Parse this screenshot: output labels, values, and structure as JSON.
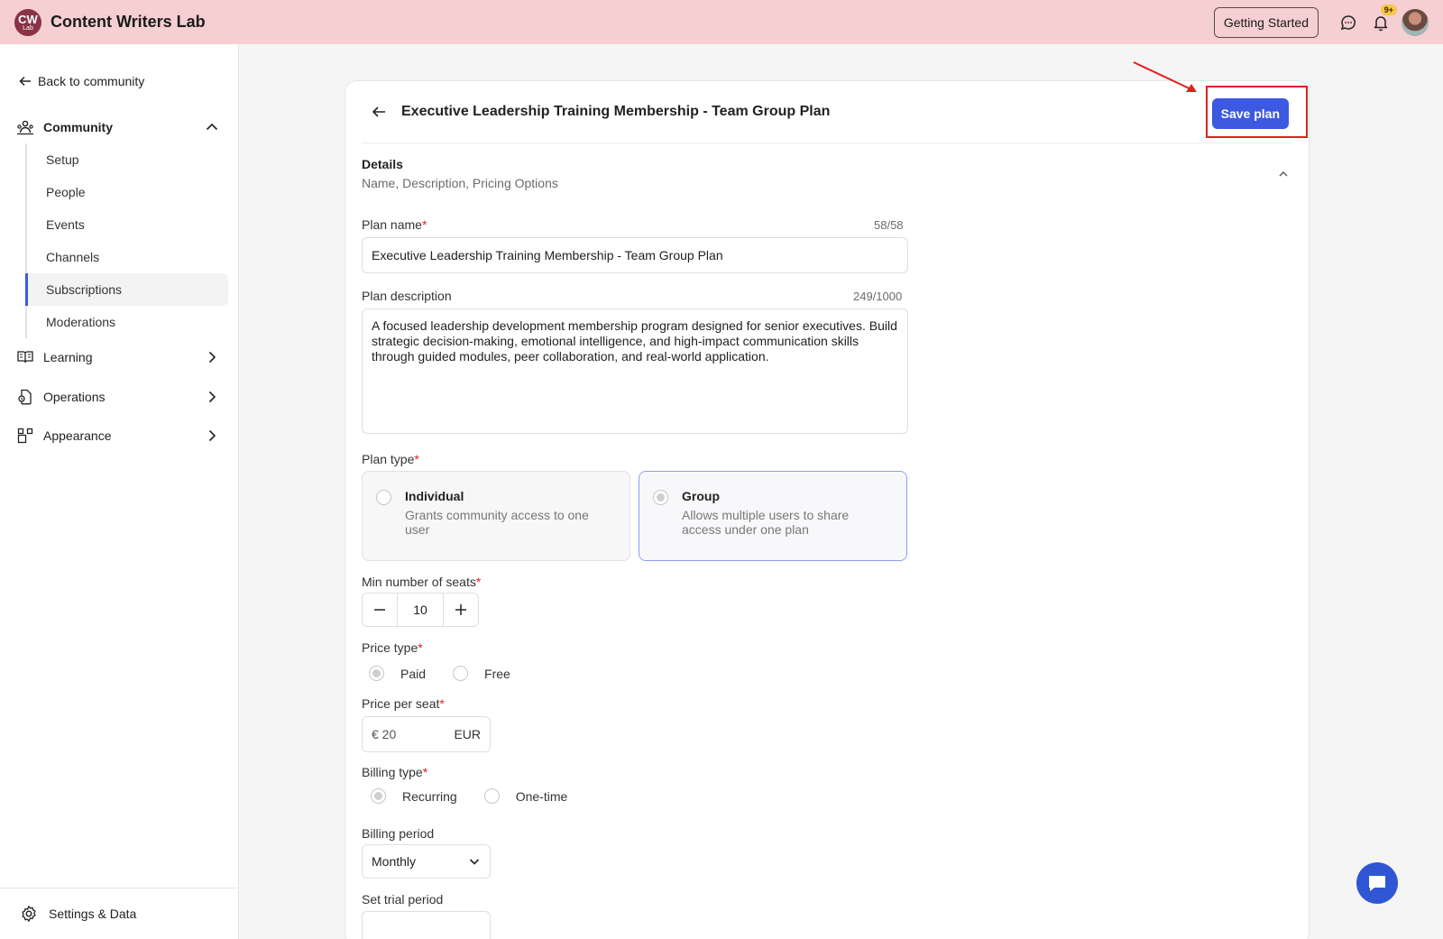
{
  "app": {
    "logo_main": "CW",
    "logo_sub": "Lab",
    "title": "Content Writers Lab"
  },
  "topbar": {
    "getting_started": "Getting Started",
    "notification_badge": "9+"
  },
  "sidebar": {
    "back_label": "Back to community",
    "community_label": "Community",
    "community_items": [
      {
        "label": "Setup"
      },
      {
        "label": "People"
      },
      {
        "label": "Events"
      },
      {
        "label": "Channels"
      },
      {
        "label": "Subscriptions",
        "active": true
      },
      {
        "label": "Moderations"
      }
    ],
    "learning_label": "Learning",
    "operations_label": "Operations",
    "appearance_label": "Appearance",
    "settings_label": "Settings & Data"
  },
  "plan": {
    "title": "Executive Leadership Training Membership - Team Group Plan",
    "save_label": "Save plan",
    "section_title": "Details",
    "section_subtitle": "Name, Description, Pricing Options",
    "name_label": "Plan name",
    "name_counter": "58/58",
    "name_value": "Executive Leadership Training Membership - Team Group Plan",
    "description_label": "Plan description",
    "description_counter": "249/1000",
    "description_value": "A focused leadership development membership program designed for senior executives. Build strategic decision-making, emotional intelligence, and high-impact communication skills through guided modules, peer collaboration, and real-world application.",
    "type_label": "Plan type",
    "type_options": [
      {
        "title": "Individual",
        "desc": "Grants community access to one user",
        "selected": false
      },
      {
        "title": "Group",
        "desc": "Allows multiple users to share access under one plan",
        "selected": true
      }
    ],
    "seats_label": "Min number of seats",
    "seats_value": "10",
    "price_type_label": "Price type",
    "price_type_options": [
      "Paid",
      "Free"
    ],
    "price_type_selected": "Paid",
    "price_label": "Price per seat",
    "price_value": "€ 20",
    "currency": "EUR",
    "billing_type_label": "Billing type",
    "billing_type_options": [
      "Recurring",
      "One-time"
    ],
    "billing_type_selected": "Recurring",
    "billing_period_label": "Billing period",
    "billing_period_value": "Monthly",
    "trial_label": "Set trial period"
  },
  "colors": {
    "topbar": "#f5cfd1",
    "primary": "#3c59e0",
    "highlight": "#e02020"
  }
}
